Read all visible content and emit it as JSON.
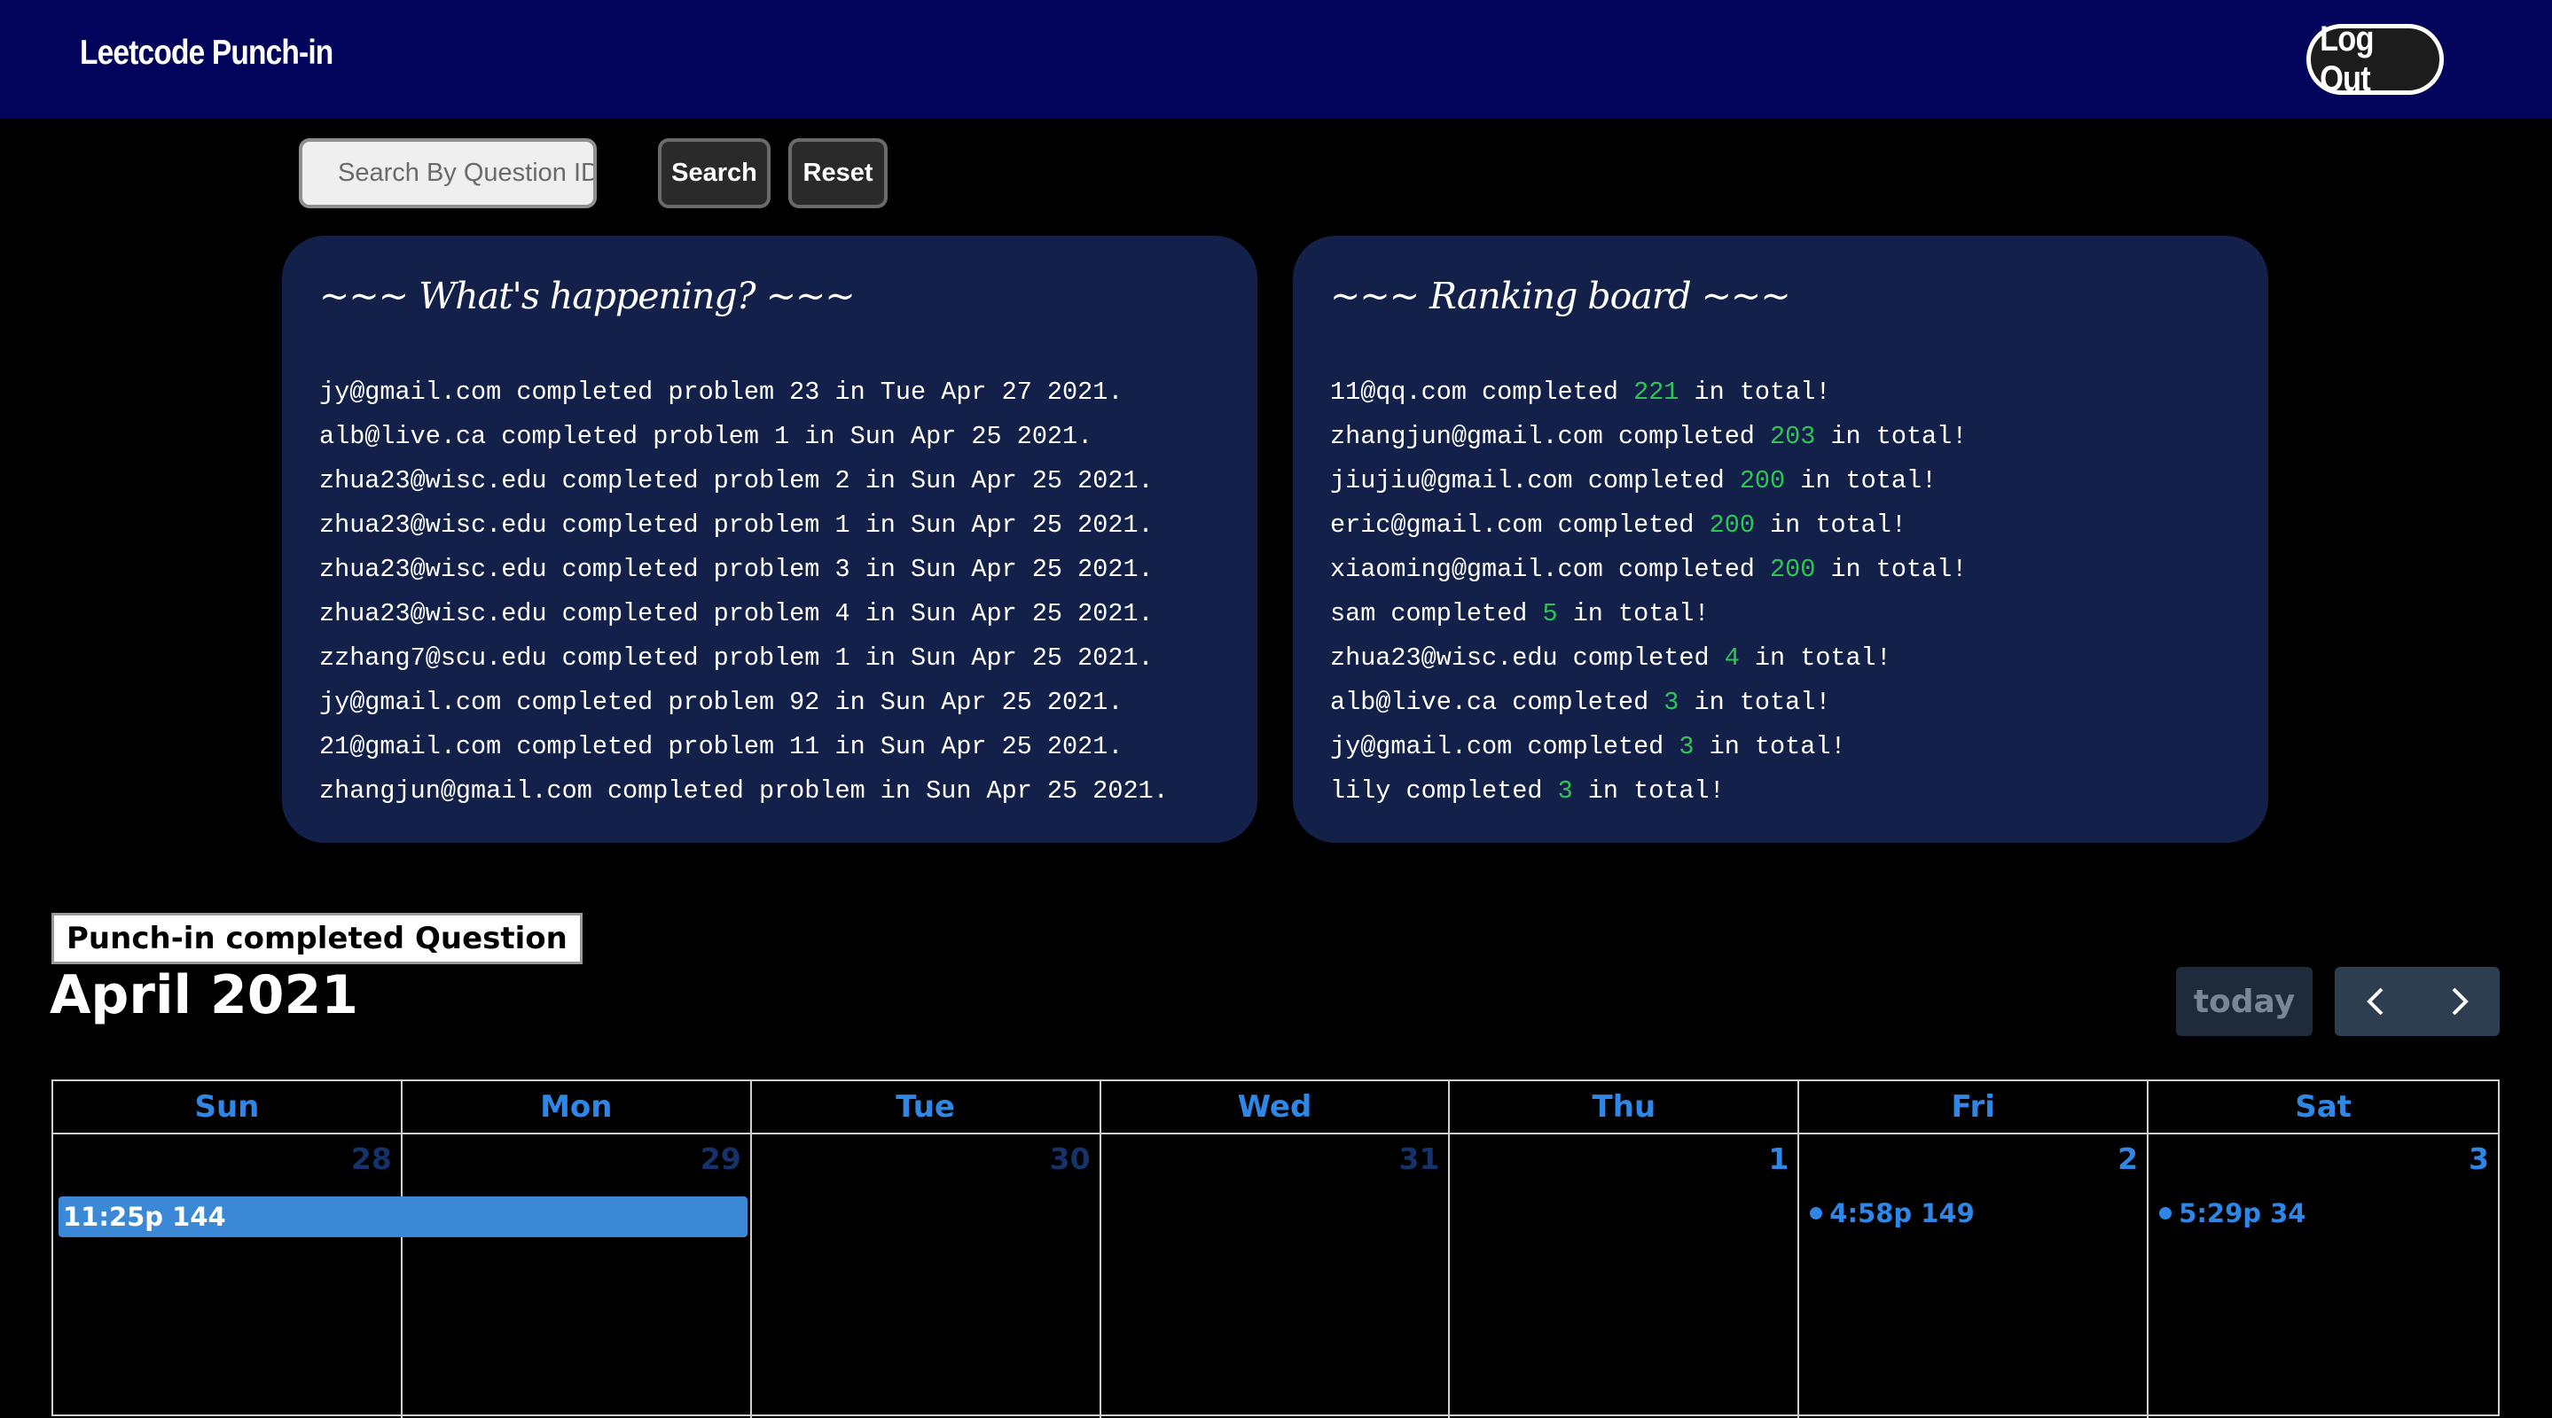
{
  "header": {
    "brand": "Leetcode Punch-in",
    "logout_label": "Log Out"
  },
  "search": {
    "placeholder": "Search By Question ID",
    "search_label": "Search",
    "reset_label": "Reset"
  },
  "activity": {
    "title": "~~~ What's happening? ~~~",
    "items": [
      "jy@gmail.com completed problem 23 in Tue Apr 27 2021.",
      "alb@live.ca completed problem 1 in Sun Apr 25 2021.",
      "zhua23@wisc.edu completed problem 2 in Sun Apr 25 2021.",
      "zhua23@wisc.edu completed problem 1 in Sun Apr 25 2021.",
      "zhua23@wisc.edu completed problem 3 in Sun Apr 25 2021.",
      "zhua23@wisc.edu completed problem 4 in Sun Apr 25 2021.",
      "zzhang7@scu.edu completed problem 1 in Sun Apr 25 2021.",
      "jy@gmail.com completed problem 92 in Sun Apr 25 2021.",
      "21@gmail.com completed problem 11 in Sun Apr 25 2021.",
      "zhangjun@gmail.com completed problem in Sun Apr 25 2021."
    ]
  },
  "ranking": {
    "title": "~~~ Ranking board ~~~",
    "word_completed": "completed",
    "word_in_total": "in total!",
    "count_color": "#2dc653",
    "items": [
      {
        "user": "11@qq.com",
        "count": "221"
      },
      {
        "user": "zhangjun@gmail.com",
        "count": "203"
      },
      {
        "user": "jiujiu@gmail.com",
        "count": "200"
      },
      {
        "user": "eric@gmail.com",
        "count": "200"
      },
      {
        "user": "xiaoming@gmail.com",
        "count": "200"
      },
      {
        "user": "sam",
        "count": "5"
      },
      {
        "user": "zhua23@wisc.edu",
        "count": "4"
      },
      {
        "user": "alb@live.ca",
        "count": "3"
      },
      {
        "user": "jy@gmail.com",
        "count": "3"
      },
      {
        "user": "lily",
        "count": "3"
      }
    ]
  },
  "calendar": {
    "tag": "Punch-in completed Question",
    "month_title": "April 2021",
    "today_label": "today",
    "prev_icon": "chevron-left-icon",
    "next_icon": "chevron-right-icon",
    "accent_color": "#2e86e6",
    "weekdays": [
      "Sun",
      "Mon",
      "Tue",
      "Wed",
      "Thu",
      "Fri",
      "Sat"
    ],
    "days": [
      {
        "num": "28",
        "other_month": true
      },
      {
        "num": "29",
        "other_month": true
      },
      {
        "num": "30",
        "other_month": true
      },
      {
        "num": "31",
        "other_month": true
      },
      {
        "num": "1",
        "other_month": false
      },
      {
        "num": "2",
        "other_month": false
      },
      {
        "num": "3",
        "other_month": false
      }
    ],
    "events": [
      {
        "label": "11:25p 144",
        "style": "bar"
      },
      {
        "label": "4:58p 149",
        "style": "dot"
      },
      {
        "label": "5:29p 34",
        "style": "dot"
      }
    ]
  }
}
